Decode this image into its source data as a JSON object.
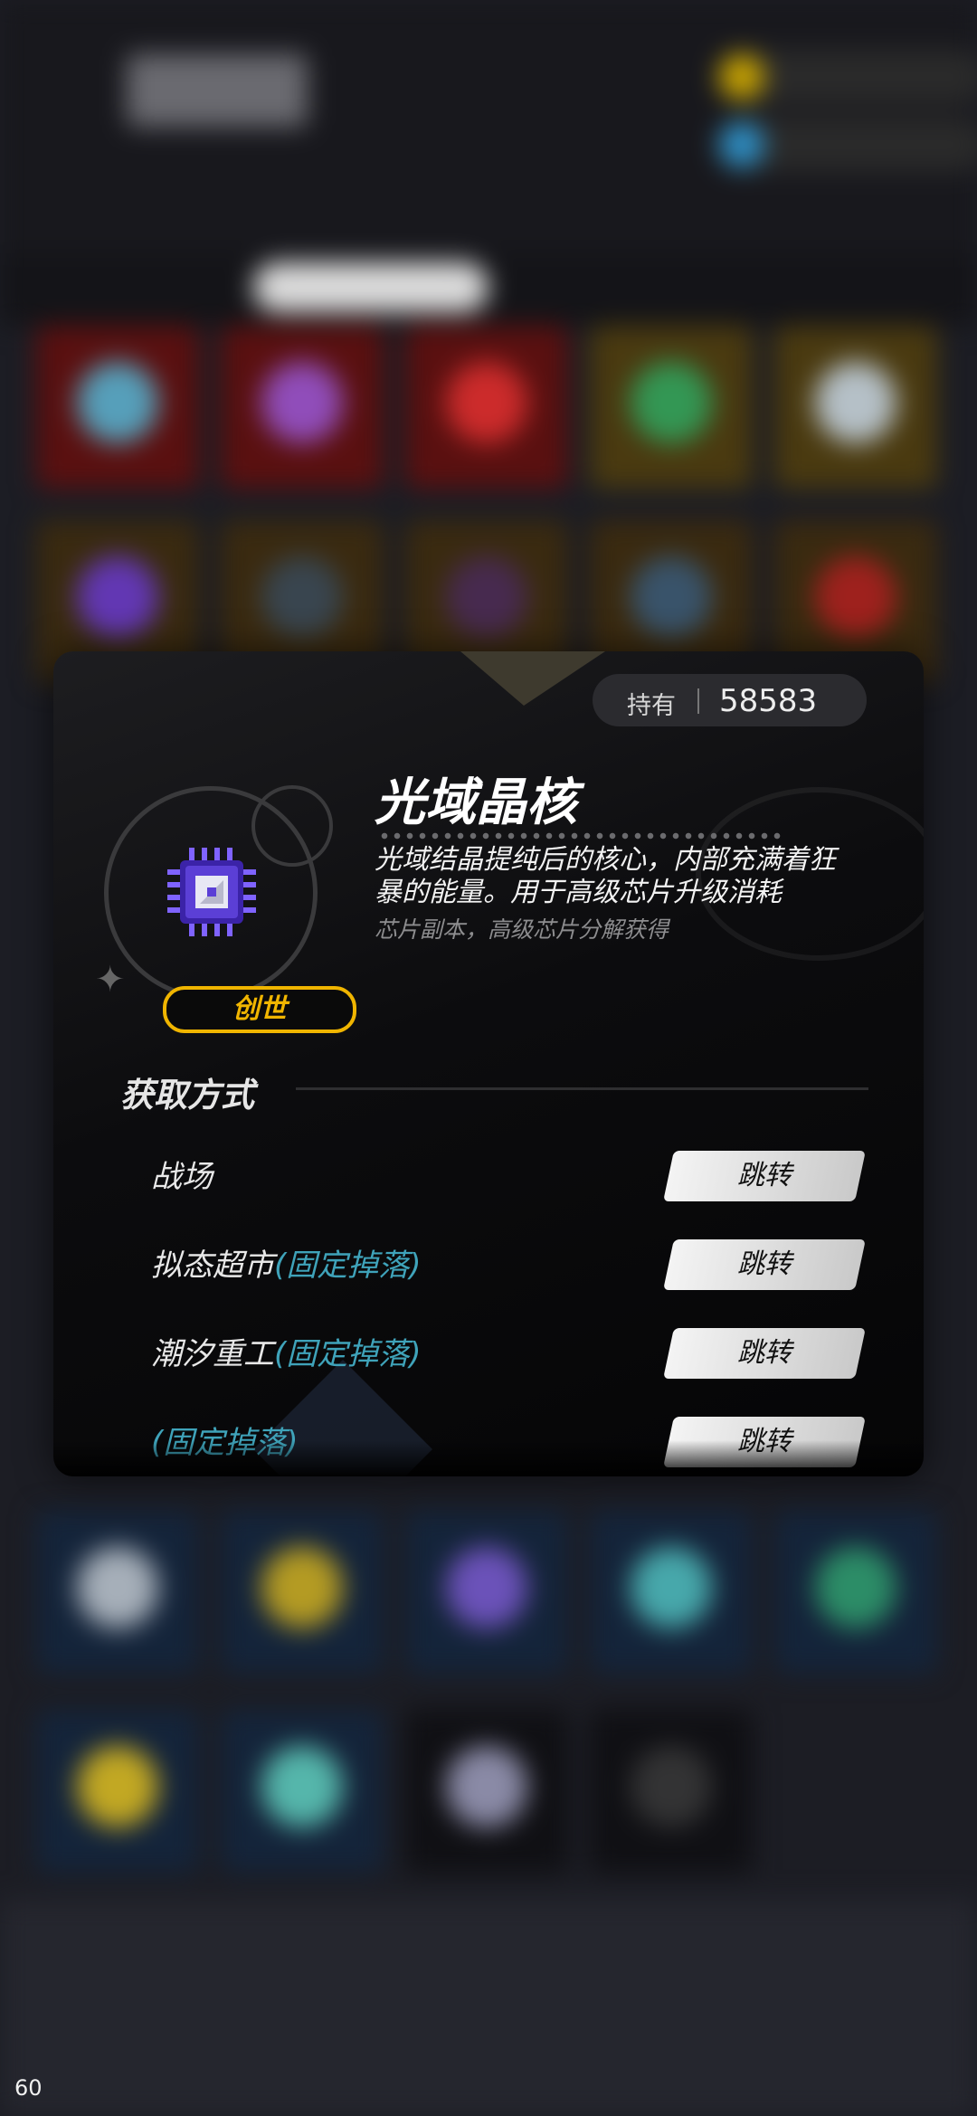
{
  "popup": {
    "owned_label": "持有",
    "owned_value": "58583",
    "item_name": "光域晶核",
    "description": "光域结晶提纯后的核心，内部充满着狂暴的能量。用于高级芯片升级消耗",
    "source_text": "芯片副本，高级芯片分解获得",
    "rarity": "创世",
    "section_title": "获取方式",
    "acquire_methods": [
      {
        "label": "战场",
        "tag": "",
        "button": "跳转"
      },
      {
        "label": "拟态超市",
        "tag": "(固定掉落)",
        "button": "跳转"
      },
      {
        "label": "潮汐重工",
        "tag": "(固定掉落)",
        "button": "跳转"
      },
      {
        "label": "",
        "tag": "(固定掉落)",
        "button": "跳转"
      }
    ]
  },
  "fps_counter": "60",
  "colors": {
    "rarity_gold": "#f0b500",
    "tag_teal": "#3fa3ba",
    "chip_purple": "#5b3fd6"
  },
  "icons": {
    "item_icon": "purple-chip-core-icon",
    "sparkle": "sparkle-icon"
  }
}
